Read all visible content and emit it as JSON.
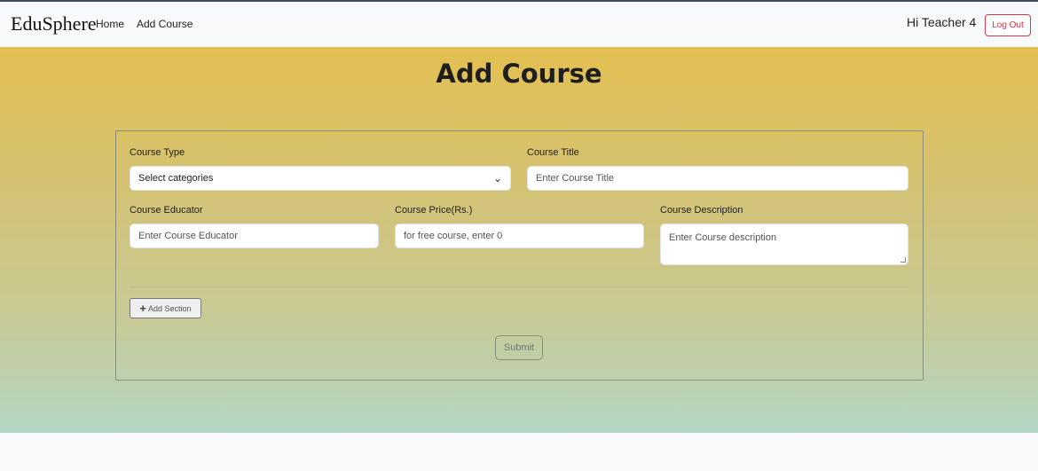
{
  "navbar": {
    "brand": "EduSphere",
    "links": [
      "Home",
      "Add Course"
    ],
    "greeting": "Hi Teacher 4",
    "logout_label": "Log Out"
  },
  "page": {
    "title": "Add Course"
  },
  "form": {
    "course_type": {
      "label": "Course Type",
      "selected": "Select categories"
    },
    "course_title": {
      "label": "Course Title",
      "placeholder": "Enter Course Title"
    },
    "course_educator": {
      "label": "Course Educator",
      "placeholder": "Enter Course Educator"
    },
    "course_price": {
      "label": "Course Price(Rs.)",
      "placeholder": "for free course, enter 0"
    },
    "course_description": {
      "label": "Course Description",
      "placeholder": "Enter Course description"
    },
    "add_section_label": "Add Section",
    "submit_label": "Submit"
  },
  "colors": {
    "logout": "#dc3545",
    "hero_top": "#e4bf50",
    "hero_bottom": "#b3d6c4"
  },
  "icons": {
    "select": "chevron-down-icon",
    "add": "plus-icon"
  }
}
